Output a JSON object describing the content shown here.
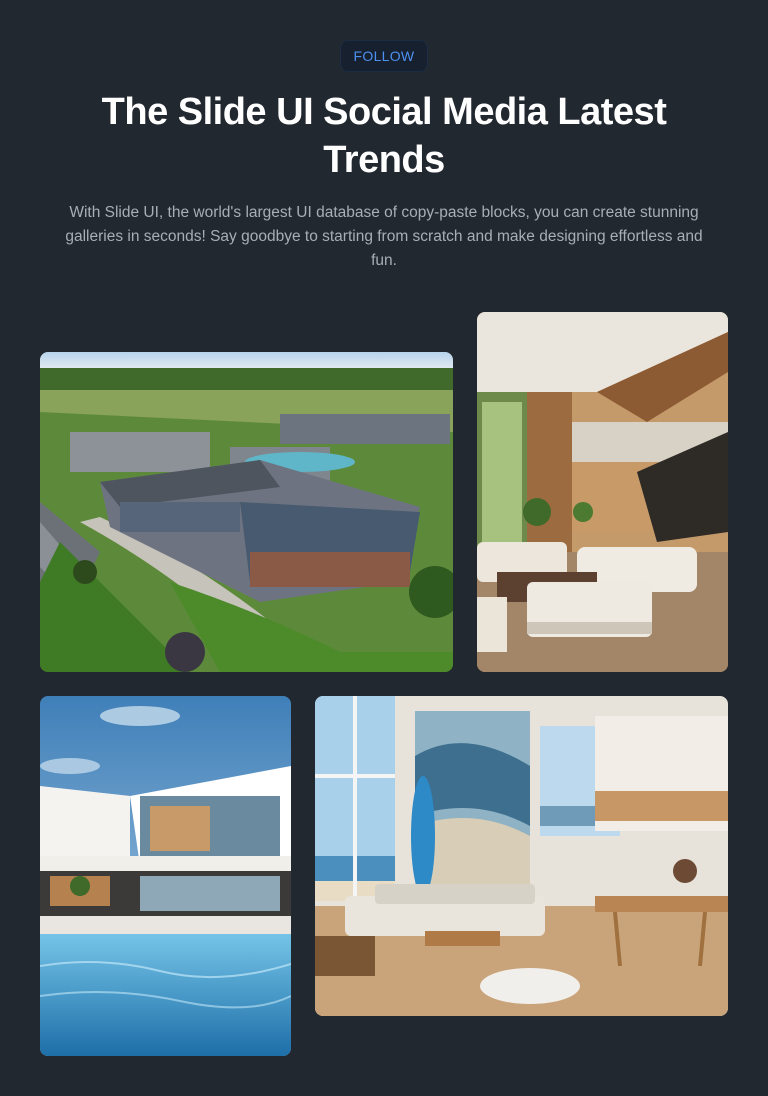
{
  "header": {
    "badge_label": "FOLLOW",
    "title": "The Slide UI Social Media Latest Trends",
    "description": "With Slide UI, the world's largest UI database of copy-paste blocks, you can create stunning galleries in seconds! Say goodbye to starting from scratch and make designing effortless and fun."
  },
  "gallery": {
    "images": [
      {
        "subject": "aerial view of apartment complex with lawns and pool"
      },
      {
        "subject": "double-height modern living room with white sofas"
      },
      {
        "subject": "modern white villa with swimming pool"
      },
      {
        "subject": "beach house living room with surfboard and wave painting"
      }
    ]
  },
  "colors": {
    "background": "#22282f",
    "accent": "#4d90f0",
    "badge_bg": "#16202f"
  }
}
